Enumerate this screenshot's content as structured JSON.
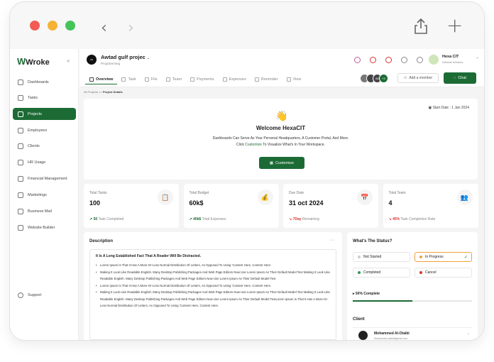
{
  "app": {
    "logo": "Wroke"
  },
  "sidebar": {
    "items": [
      {
        "label": "Dashboards",
        "icon": "dashboard-icon"
      },
      {
        "label": "Tasks",
        "icon": "tasks-icon"
      },
      {
        "label": "Projects",
        "icon": "folder-icon",
        "active": true
      },
      {
        "label": "Employees",
        "icon": "people-icon"
      },
      {
        "label": "Clients",
        "icon": "user-icon"
      },
      {
        "label": "HR Usage",
        "icon": "hr-icon"
      },
      {
        "label": "Financial Management",
        "icon": "finance-icon"
      },
      {
        "label": "Marketings",
        "icon": "megaphone-icon"
      },
      {
        "label": "Business Mail",
        "icon": "mail-icon"
      },
      {
        "label": "Website Builder",
        "icon": "builder-icon"
      }
    ],
    "support": "Support"
  },
  "header": {
    "project_name": "Awtad gulf projec",
    "project_type": "Programming",
    "user_name": "Hexa CIT",
    "user_role": "Software Solutions"
  },
  "tabs": [
    {
      "label": "Overview",
      "active": true
    },
    {
      "label": "Task"
    },
    {
      "label": "File"
    },
    {
      "label": "Team"
    },
    {
      "label": "Payments"
    },
    {
      "label": "Expenses"
    },
    {
      "label": "Reminder"
    },
    {
      "label": "View"
    }
  ],
  "avatars_more": "+3",
  "add_member": "Add a member",
  "chat": "Chat",
  "breadcrumb": {
    "parent": "All Projects",
    "sep": ">>",
    "current": "Project Details"
  },
  "welcome": {
    "start_date": "Start Date : 1 Jan 2024",
    "title": "Welcome HexaCIT",
    "line1": "Dashboards Can Serve As Your Personal Headquarters, A Customer Portal, And More.",
    "line2_pre": "Click ",
    "line2_link": "Customize",
    "line2_post": " To Visualize What's In Your Workspace.",
    "button": "Customize"
  },
  "stats": [
    {
      "label": "Total Tasks",
      "value": "100",
      "delta": "50",
      "foot": "Task Completed",
      "trend": "up"
    },
    {
      "label": "Total Budget",
      "value": "60k$",
      "delta": "40k$",
      "foot": "Total Expenses",
      "trend": "up"
    },
    {
      "label": "Due Date",
      "value": "31 oct 2024",
      "delta": "7Day",
      "foot": "Remaining",
      "trend": "down"
    },
    {
      "label": "Total Team",
      "value": "4",
      "delta": "45%",
      "foot": "Task Completion Rate",
      "trend": "down"
    }
  ],
  "description": {
    "title": "Description",
    "heading": "It Is A Long Established Fact That A Reader Will Be Distracted.",
    "bullets": [
      "Lorem Ipsum Is That It Has A More-Or-Less Normal Distribution Of Letters, As Opposed To Using 'Content Here, Content Here.",
      "Making It Look Like Readable English. Many Desktop Publishing Packages And Web Page Editors Now Use Lorem Ipsum As Their Default Model Text Making It Look Like Readable English. Many Desktop Publishing Packages And Web Page Editors Now Use Lorem Ipsum As Their Default Model Text",
      "Lorem Ipsum Is That It Has A More-Or-Less Normal Distribution Of Letters, As Opposed To Using 'Content Here, Content Here.",
      "Making It Look Like Readable English. Many Desktop Publishing Packages And Web Page Editors Now Use Lorem Ipsum As Their Default Model Text Making It Look Like Readable English. Many Desktop Publishing Packages And Web Page Editors Now Use Lorem Ipsum As Their Default Model TextLorem Ipsum Is That It Has A More-Or-Less Normal Distribution Of Letters, As Opposed To Using 'Content Here, Content Here."
    ]
  },
  "status": {
    "title": "What's The Status?",
    "options": [
      {
        "label": "Not Started",
        "color": "#cccccc"
      },
      {
        "label": "In Progress",
        "color": "#f0a23b",
        "selected": true
      },
      {
        "label": "Completed",
        "color": "#2e9b4f"
      },
      {
        "label": "Cancel",
        "color": "#d33333"
      }
    ],
    "progress_label": "50% Complete",
    "progress": 0.5
  },
  "client": {
    "title": "Client",
    "name": "Mohammed Al-Otaibi",
    "email": "Mohammed.otaibi@gmail.com"
  }
}
